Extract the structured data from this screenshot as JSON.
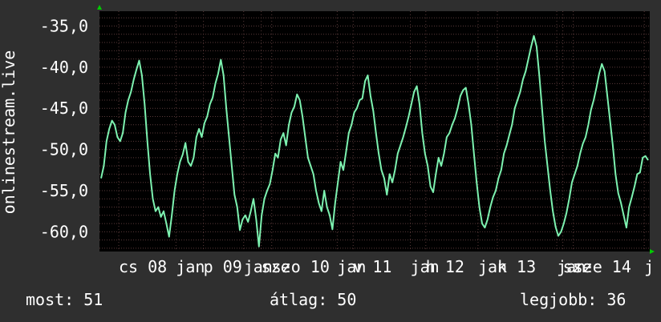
{
  "chart_data": {
    "type": "line",
    "ylabel": "onlinestream.live",
    "ylim": [
      -62.4,
      -33.2
    ],
    "y_ticks": [
      -35,
      -40,
      -45,
      -50,
      -55,
      -60
    ],
    "y_tick_labels": [
      "-35,0",
      "-40,0",
      "-45,0",
      "-50,0",
      "-55,0",
      "-60,0"
    ],
    "x_tick_labels": [
      "cs 08",
      "jan",
      "p 09",
      "jan",
      "sze",
      "szo 10",
      "jan",
      "v 11",
      "jan",
      "h 12",
      "jan",
      "k 13",
      "jan",
      "sze",
      "sze 14",
      "j"
    ],
    "x_tick_positions": [
      0.035,
      0.139,
      0.189,
      0.262,
      0.294,
      0.313,
      0.432,
      0.461,
      0.565,
      0.593,
      0.688,
      0.723,
      0.831,
      0.842,
      0.861,
      0.99
    ],
    "grid": true,
    "colors": {
      "line": "#7df2b0",
      "grid": "#5a3a3a",
      "axis_arrow": "#00cc00",
      "plot_bg": "#000000",
      "page_bg": "#2f2f2f"
    },
    "series": [
      {
        "values": [
          -53.5,
          -52,
          -49,
          -47.5,
          -46.5,
          -47,
          -48.5,
          -49,
          -48,
          -45.5,
          -44,
          -43,
          -41.5,
          -40.3,
          -39.2,
          -41,
          -44.5,
          -49,
          -53,
          -56,
          -57.5,
          -57,
          -58.2,
          -57.5,
          -59,
          -60.6,
          -58,
          -55,
          -53,
          -51.5,
          -50.6,
          -49.2,
          -51.5,
          -52,
          -51,
          -48.5,
          -47.5,
          -48.5,
          -46.8,
          -46,
          -44.5,
          -43.7,
          -42,
          -40.8,
          -39.1,
          -41,
          -45,
          -48.5,
          -52,
          -55.5,
          -57,
          -59.8,
          -58.5,
          -58,
          -58.8,
          -57.5,
          -56,
          -58.5,
          -61.8,
          -58,
          -56,
          -55,
          -54.2,
          -52.5,
          -50.5,
          -51,
          -48.8,
          -48,
          -49.5,
          -47,
          -45.5,
          -44.8,
          -43.3,
          -44,
          -46,
          -48.5,
          -51,
          -52,
          -53,
          -55,
          -56.5,
          -57.5,
          -55,
          -57,
          -58,
          -59.7,
          -56.5,
          -54,
          -51.5,
          -52.5,
          -50.3,
          -48,
          -47,
          -45.5,
          -45,
          -44,
          -43.8,
          -41.7,
          -41,
          -43.5,
          -45.3,
          -48,
          -50.5,
          -52.5,
          -53.5,
          -55.5,
          -53,
          -54,
          -52.5,
          -50.5,
          -49.5,
          -48.5,
          -47.3,
          -46,
          -44.5,
          -43,
          -42.3,
          -44.5,
          -48,
          -50.5,
          -52,
          -54.5,
          -55.2,
          -53,
          -51,
          -52,
          -50.5,
          -48.5,
          -48,
          -47,
          -46.2,
          -45,
          -43.5,
          -42.8,
          -42.5,
          -44.5,
          -47,
          -50.5,
          -54,
          -57,
          -59,
          -59.5,
          -58.5,
          -57,
          -55.8,
          -55,
          -53.5,
          -52.5,
          -50.5,
          -49.5,
          -48.2,
          -47,
          -45,
          -44,
          -43,
          -41.5,
          -40.5,
          -39,
          -37.5,
          -36.2,
          -37.5,
          -41,
          -45,
          -49,
          -52,
          -55,
          -57.5,
          -59.4,
          -60.5,
          -60,
          -59,
          -57.7,
          -56,
          -54,
          -53,
          -52,
          -50.5,
          -49.3,
          -48.5,
          -47,
          -45.2,
          -44,
          -42.5,
          -40.8,
          -39.6,
          -40.5,
          -43.5,
          -46.5,
          -49.5,
          -53,
          -55.3,
          -56.5,
          -58,
          -59.5,
          -57,
          -55.8,
          -54.5,
          -53,
          -52.8,
          -51,
          -50.8,
          -51.3
        ]
      }
    ]
  },
  "footer": {
    "current": "most: 51",
    "average": "átlag: 50",
    "best": "legjobb: 36"
  }
}
